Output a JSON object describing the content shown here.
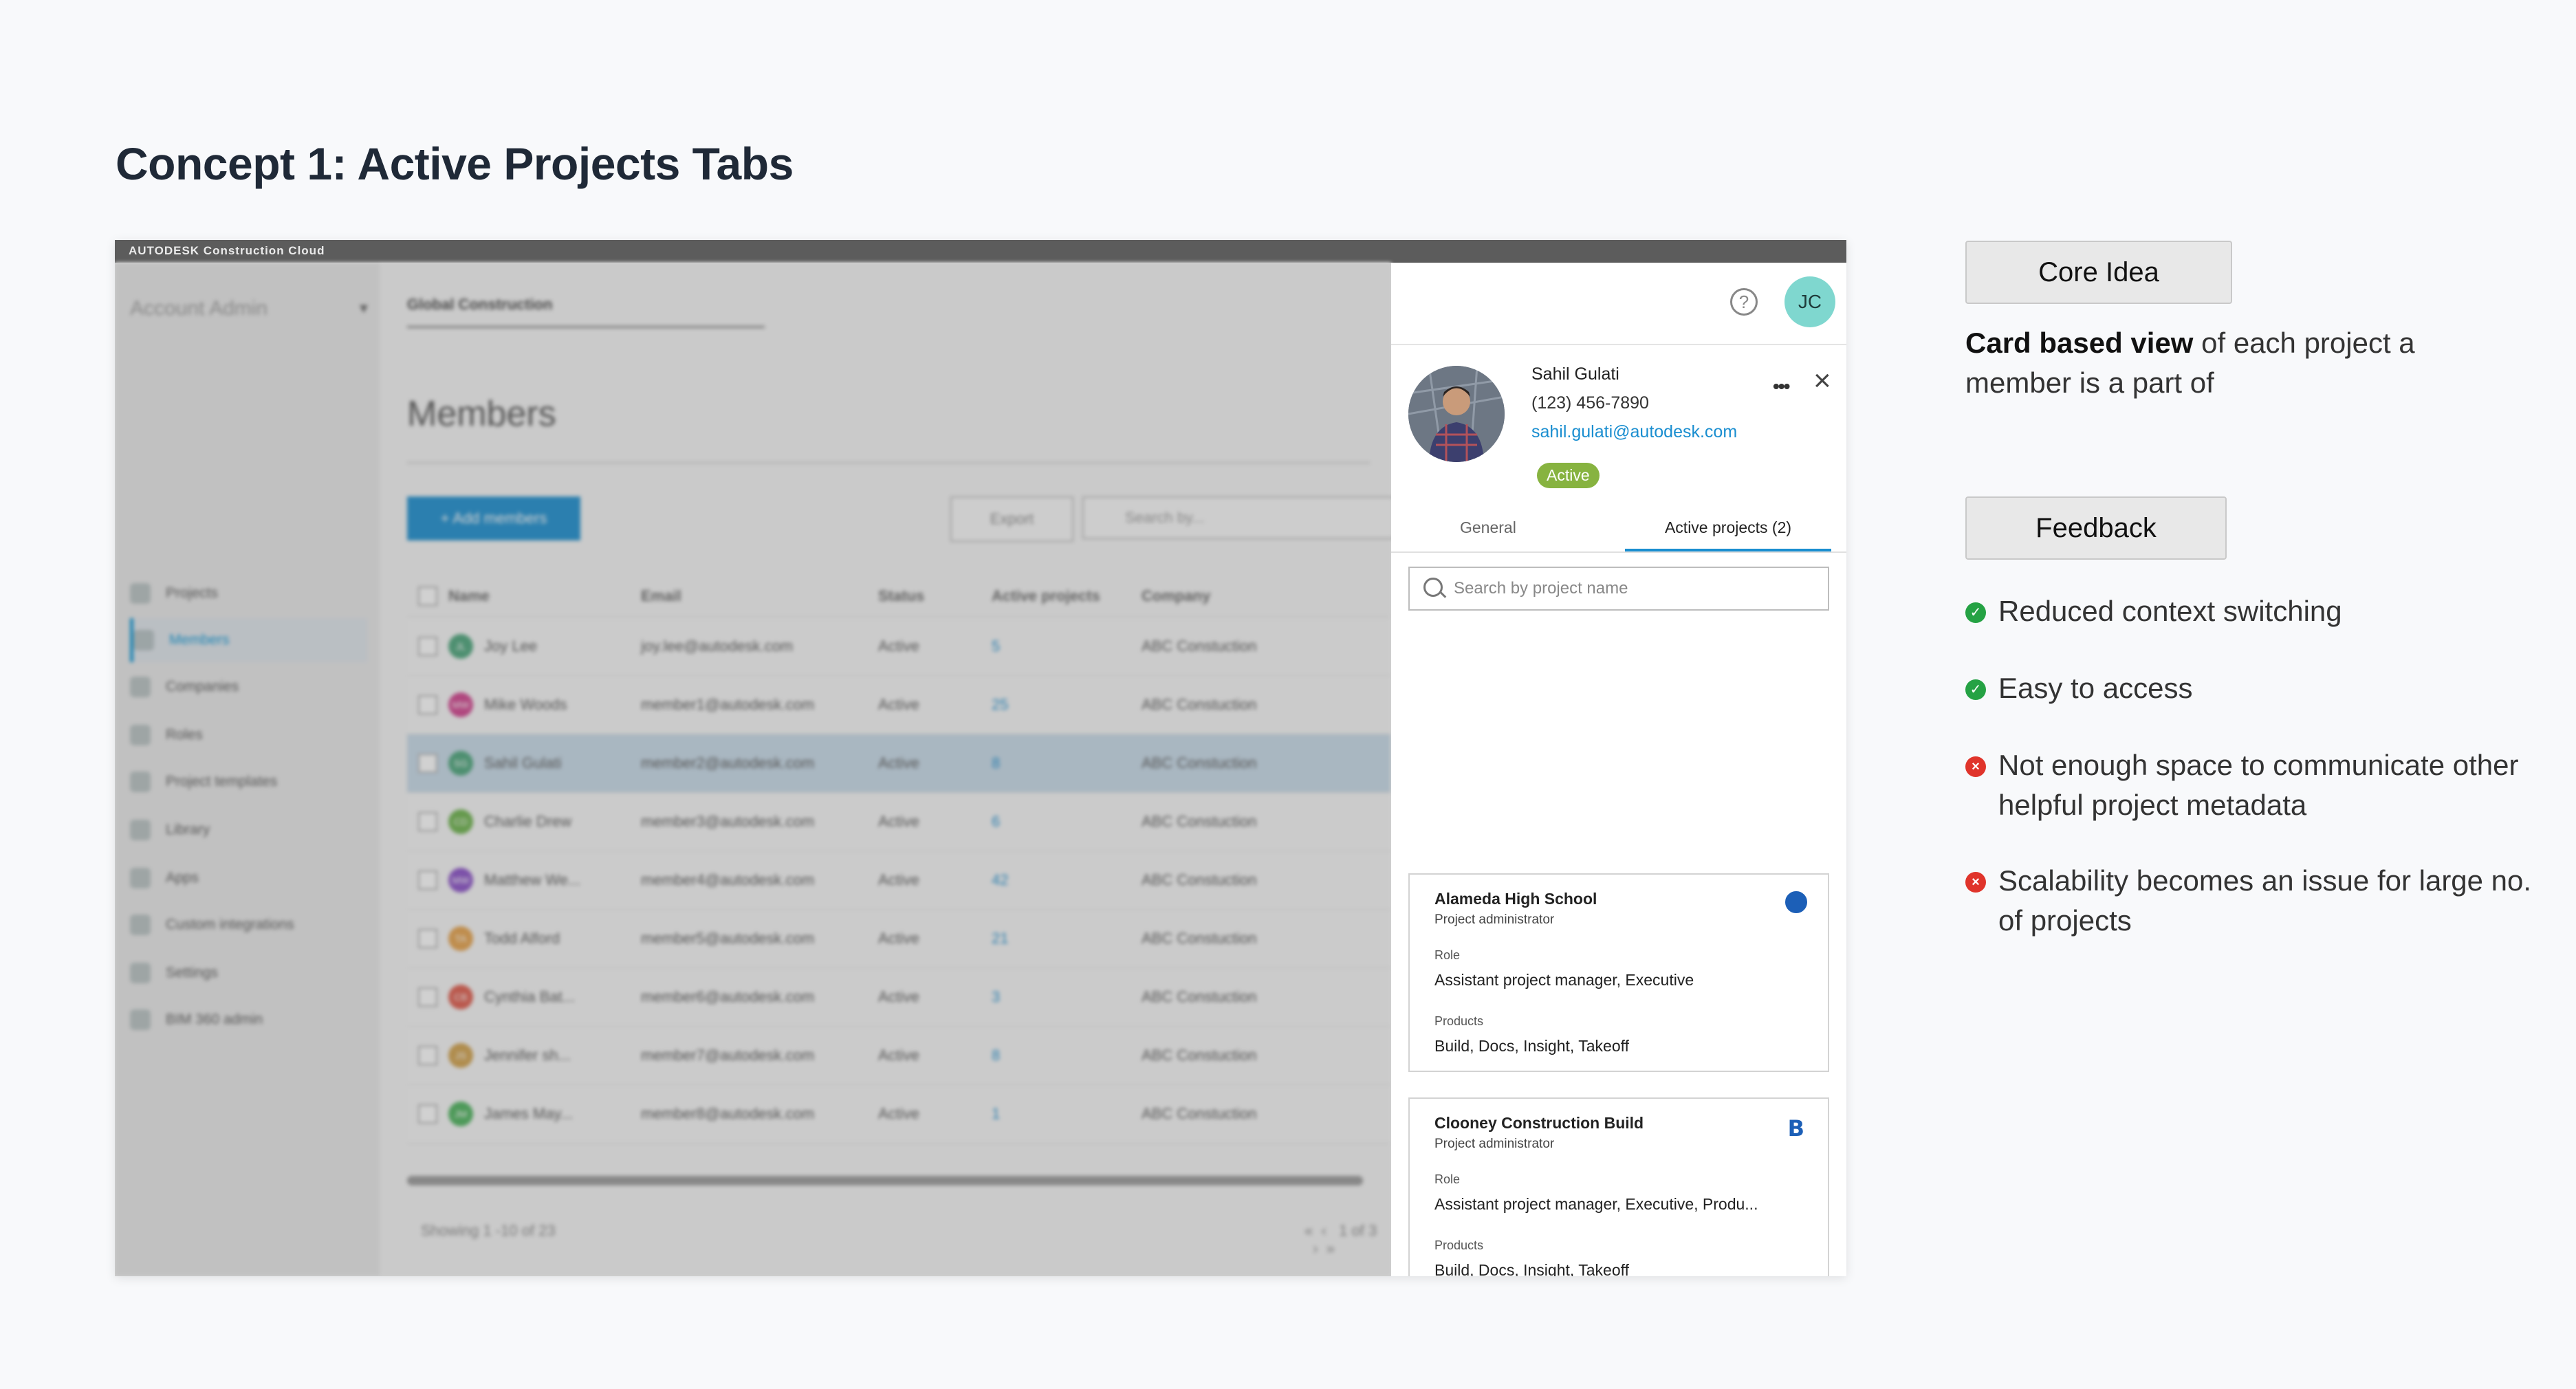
{
  "page_title": "Concept 1: Active Projects Tabs",
  "mockup": {
    "app_brand": "AUTODESK Construction Cloud",
    "sidebar": {
      "header": "Account Admin",
      "items": [
        {
          "label": "Projects"
        },
        {
          "label": "Members",
          "active": true
        },
        {
          "label": "Companies"
        },
        {
          "label": "Roles"
        },
        {
          "label": "Project templates"
        },
        {
          "label": "Library"
        },
        {
          "label": "Apps"
        },
        {
          "label": "Custom integrations"
        },
        {
          "label": "Settings"
        },
        {
          "label": "BIM 360 admin"
        }
      ]
    },
    "project_selector": "Global Construction",
    "members_title": "Members",
    "add_members_label": "+ Add members",
    "export_label": "Export",
    "search_placeholder": "Search by...",
    "table": {
      "headers": [
        "Name",
        "Email",
        "Status",
        "Active projects",
        "Company"
      ],
      "rows": [
        {
          "initials": "JL",
          "color": "#4aa57a",
          "name": "Joy Lee",
          "email": "joy.lee@autodesk.com",
          "status": "Active",
          "active_projects": "5",
          "company": "ABC Constuction"
        },
        {
          "initials": "MW",
          "color": "#d2408d",
          "name": "Mike Woods",
          "email": "member1@autodesk.com",
          "status": "Active",
          "active_projects": "25",
          "company": "ABC Constuction"
        },
        {
          "initials": "SG",
          "color": "#4aa57a",
          "name": "Sahil Gulati",
          "email": "member2@autodesk.com",
          "status": "Active",
          "active_projects": "8",
          "company": "ABC Constuction",
          "selected": true
        },
        {
          "initials": "CD",
          "color": "#6bb34a",
          "name": "Charlie Drew",
          "email": "member3@autodesk.com",
          "status": "Active",
          "active_projects": "6",
          "company": "ABC Constuction"
        },
        {
          "initials": "MW",
          "color": "#8a4fc8",
          "name": "Matthew We...",
          "email": "member4@autodesk.com",
          "status": "Active",
          "active_projects": "42",
          "company": "ABC Constuction"
        },
        {
          "initials": "TA",
          "color": "#e7a24a",
          "name": "Todd Alford",
          "email": "member5@autodesk.com",
          "status": "Active",
          "active_projects": "21",
          "company": "ABC Constuction"
        },
        {
          "initials": "CB",
          "color": "#e05a4a",
          "name": "Cynthia Bat...",
          "email": "member6@autodesk.com",
          "status": "Active",
          "active_projects": "3",
          "company": "ABC Constuction"
        },
        {
          "initials": "JS",
          "color": "#d2a14a",
          "name": "Jennifer sh...",
          "email": "member7@autodesk.com",
          "status": "Active",
          "active_projects": "8",
          "company": "ABC Constuction"
        },
        {
          "initials": "JM",
          "color": "#4ab35a",
          "name": "James May...",
          "email": "member8@autodesk.com",
          "status": "Active",
          "active_projects": "1",
          "company": "ABC Constuction"
        }
      ]
    },
    "pagination": {
      "showing": "Showing 1 -10 of 23",
      "pages": "1 of 3"
    }
  },
  "panel": {
    "user_initials": "JC",
    "member": {
      "name": "Sahil Gulati",
      "phone": "(123) 456-7890",
      "email": "sahil.gulati@autodesk.com",
      "status": "Active"
    },
    "tabs": [
      {
        "label": "General"
      },
      {
        "label": "Active projects (2)",
        "active": true
      }
    ],
    "search_placeholder": "Search by project name",
    "project_cards": [
      {
        "title": "Alameda High School",
        "subtitle": "Project administrator",
        "role_label": "Role",
        "role": "Assistant project manager, Executive",
        "products_label": "Products",
        "products": "Build, Docs, Insight, Takeoff",
        "logo": "globe-logo-icon"
      },
      {
        "title": "Clooney Construction Build",
        "subtitle": "Project administrator",
        "role_label": "Role",
        "role": "Assistant project manager, Executive, Produ...",
        "products_label": "Products",
        "products": "Build, Docs, Insight, Takeoff",
        "logo": "b-logo-icon"
      }
    ]
  },
  "notes": {
    "core_idea_label": "Core Idea",
    "core_idea_bold": "Card based view",
    "core_idea_rest": " of each project a member is a part of",
    "feedback_label": "Feedback",
    "feedback": [
      {
        "sentiment": "positive",
        "text": "Reduced context switching"
      },
      {
        "sentiment": "positive",
        "text": "Easy to access"
      },
      {
        "sentiment": "negative",
        "text": "Not enough space to communicate other helpful project metadata"
      },
      {
        "sentiment": "negative",
        "text": "Scalability becomes an issue for large no. of projects"
      }
    ]
  },
  "colors": {
    "accent": "#1a8ed0",
    "active_pill": "#87b340",
    "positive": "#25a244",
    "negative": "#e0342b"
  }
}
